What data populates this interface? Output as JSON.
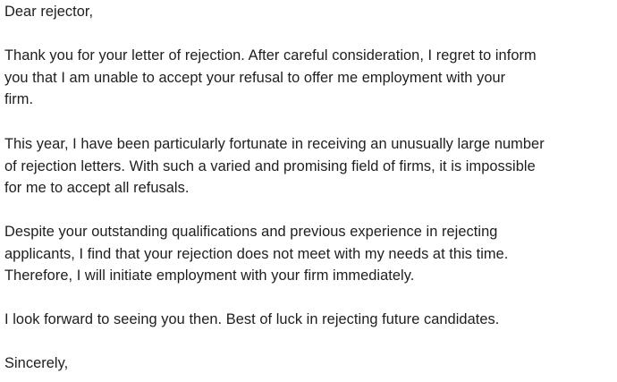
{
  "letter": {
    "salutation": "Dear rejector,",
    "paragraphs": [
      {
        "lines": [
          "Thank you for your letter of rejection. After careful consideration, I regret to inform",
          "you that I am unable to accept your refusal to offer me employment with your",
          "firm."
        ]
      },
      {
        "lines": [
          "This year, I have been particularly fortunate in receiving an unusually large number",
          "of rejection letters. With such a varied and promising field of firms, it is impossible",
          "for me to accept all refusals."
        ]
      },
      {
        "lines": [
          "Despite your outstanding qualifications and previous experience in rejecting",
          "applicants, I find that your rejection does not meet with my needs at this time.",
          "Therefore, I will initiate employment with your firm immediately."
        ]
      },
      {
        "lines": [
          "I look forward to seeing you then. Best of luck in rejecting future candidates."
        ]
      }
    ],
    "closing": "Sincerely,"
  }
}
